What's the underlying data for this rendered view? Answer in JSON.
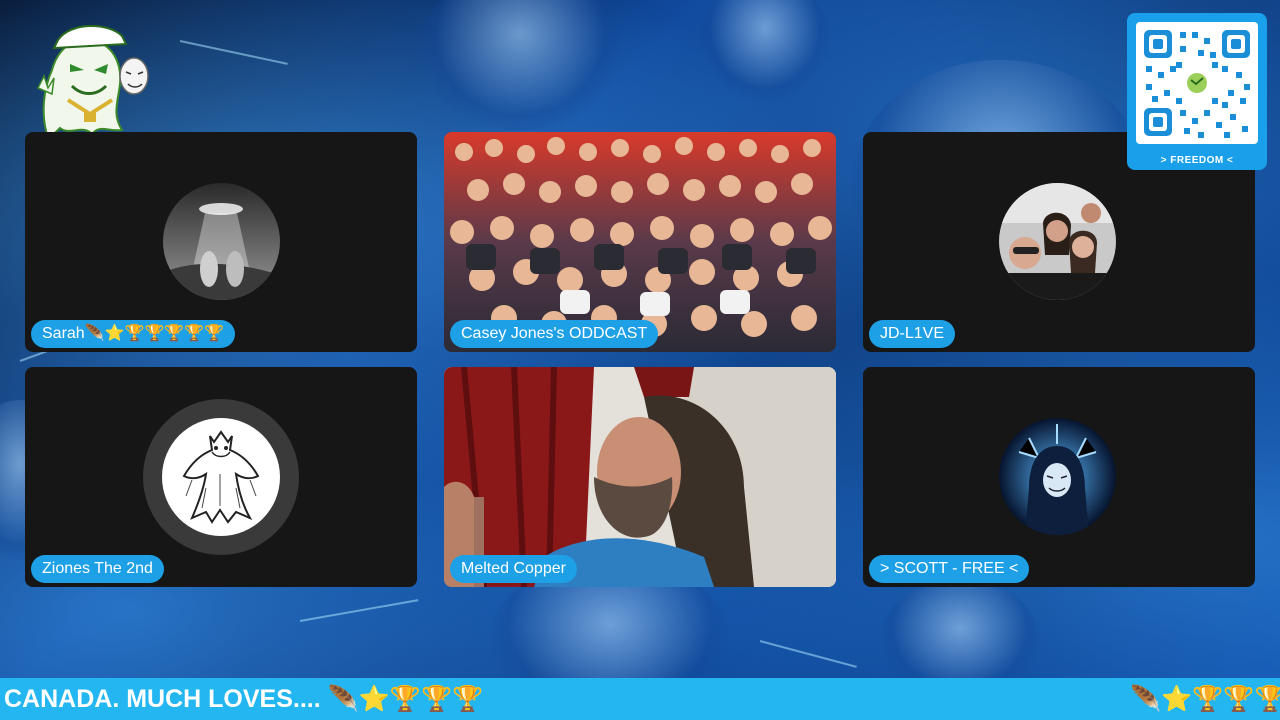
{
  "participants": [
    {
      "name": "Sarah🪶⭐🏆🏆🏆🏆🏆"
    },
    {
      "name": "Casey Jones's ODDCAST"
    },
    {
      "name": "JD-L1VE"
    },
    {
      "name": "Ziones The 2nd"
    },
    {
      "name": "Melted Copper"
    },
    {
      "name": "> SCOTT - FREE <"
    }
  ],
  "qr": {
    "label": "> FREEDOM <"
  },
  "ticker": {
    "text": "CANADA. MUCH LOVES.... 🪶⭐🏆🏆🏆",
    "trailing": "🪶⭐🏆🏆🏆"
  },
  "colors": {
    "accent": "#1ea0e6",
    "ticker_bg": "#24b6f1",
    "tile_bg": "#161616"
  }
}
